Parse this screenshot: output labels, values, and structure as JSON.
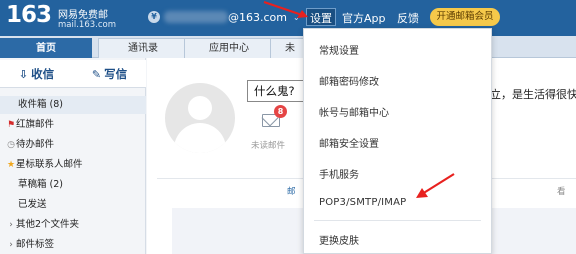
{
  "header": {
    "logo_number": "163",
    "logo_title": "网易免费邮",
    "logo_domain": "mail.163.com",
    "account_suffix": "@163.com",
    "account_chevron": "⌄",
    "nav_settings": "设置",
    "nav_app": "官方App",
    "nav_feedback": "反馈",
    "vip_button": "开通邮箱会员"
  },
  "tabs": [
    "首页",
    "通讯录",
    "应用中心",
    "未"
  ],
  "sidebar": {
    "receive": "收信",
    "compose": "写信",
    "folders": {
      "inbox": "收件箱 (8)",
      "red_flag": "红旗邮件",
      "todo": "待办邮件",
      "star_contacts": "星标联系人邮件",
      "drafts": "草稿箱 (2)",
      "sent": "已发送",
      "other": "其他2个文件夹",
      "tags": "邮件标签"
    }
  },
  "main": {
    "status_text": "什么鬼?",
    "marquee": "立，是生活得很快",
    "unread_count": "8",
    "unread_label": "未读邮件",
    "tab_left": "邮",
    "tab_right": "看"
  },
  "settings_menu": {
    "items": [
      "常规设置",
      "邮箱密码修改",
      "帐号与邮箱中心",
      "邮箱安全设置",
      "手机服务",
      "POP3/SMTP/IMAP",
      "更换皮肤"
    ]
  },
  "colors": {
    "header_bg": "#23629e",
    "vip_bg": "#f6c94a",
    "annotation_arrow": "#e8211f",
    "badge": "#e54545"
  },
  "icons": {
    "receive": "receive-icon",
    "compose": "compose-icon",
    "red_flag": "red-flag-icon",
    "todo": "clock-icon",
    "star": "star-icon",
    "mail": "envelope-icon",
    "coin": "coin-icon"
  }
}
